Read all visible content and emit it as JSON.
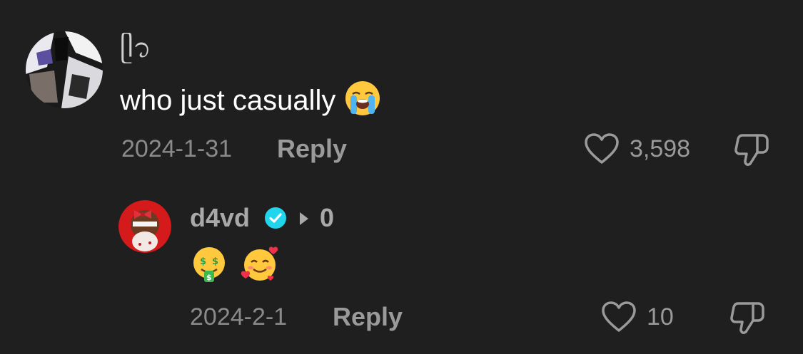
{
  "comments": [
    {
      "handle_glyph": "ᥫ᭡",
      "text": "who just casually",
      "emoji_icon": "loudly-crying-face-emoji",
      "date": "2024-1-31",
      "reply_label": "Reply",
      "likes": "3,598"
    }
  ],
  "reply": {
    "username": "d4vd",
    "verified": true,
    "replied_to": "0",
    "emoji_icons": [
      "money-mouth-face-emoji",
      "smiling-face-with-hearts-emoji"
    ],
    "date": "2024-2-1",
    "reply_label": "Reply",
    "likes": "10"
  },
  "colors": {
    "background": "#1f1f1f",
    "primary_text": "#ffffff",
    "secondary_text": "#8a8a8a",
    "verified_badge": "#20d5ec"
  }
}
